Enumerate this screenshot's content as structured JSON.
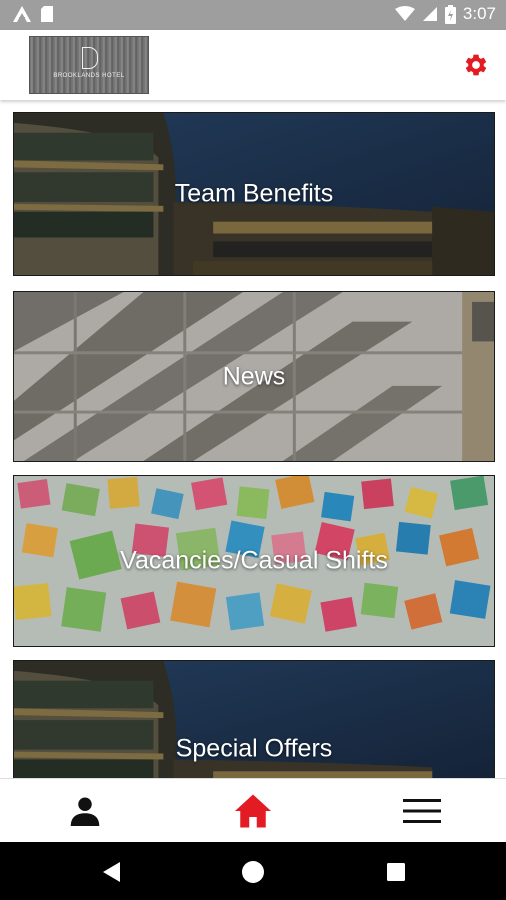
{
  "status_bar": {
    "time": "3:07",
    "icons": [
      "a-logo-icon",
      "sd-card-icon",
      "wifi-icon",
      "signal-icon",
      "battery-icon"
    ]
  },
  "header": {
    "logo_text": "BROOKLANDS HOTEL",
    "settings_icon": "gear-icon",
    "accent_color": "#e31b23"
  },
  "tiles": [
    {
      "label": "Team Benefits",
      "image": "hotel-building"
    },
    {
      "label": "News",
      "image": "wall-shadows"
    },
    {
      "label": "Vacancies/Casual Shifts",
      "image": "sticky-notes-wall"
    },
    {
      "label": "Special Offers",
      "image": "hotel-building"
    }
  ],
  "bottom_nav": {
    "items": [
      {
        "icon": "person-icon",
        "active": false
      },
      {
        "icon": "home-icon",
        "active": true
      },
      {
        "icon": "menu-icon",
        "active": false
      }
    ]
  },
  "system_nav": [
    "back-icon",
    "home-circle-icon",
    "recents-icon"
  ]
}
